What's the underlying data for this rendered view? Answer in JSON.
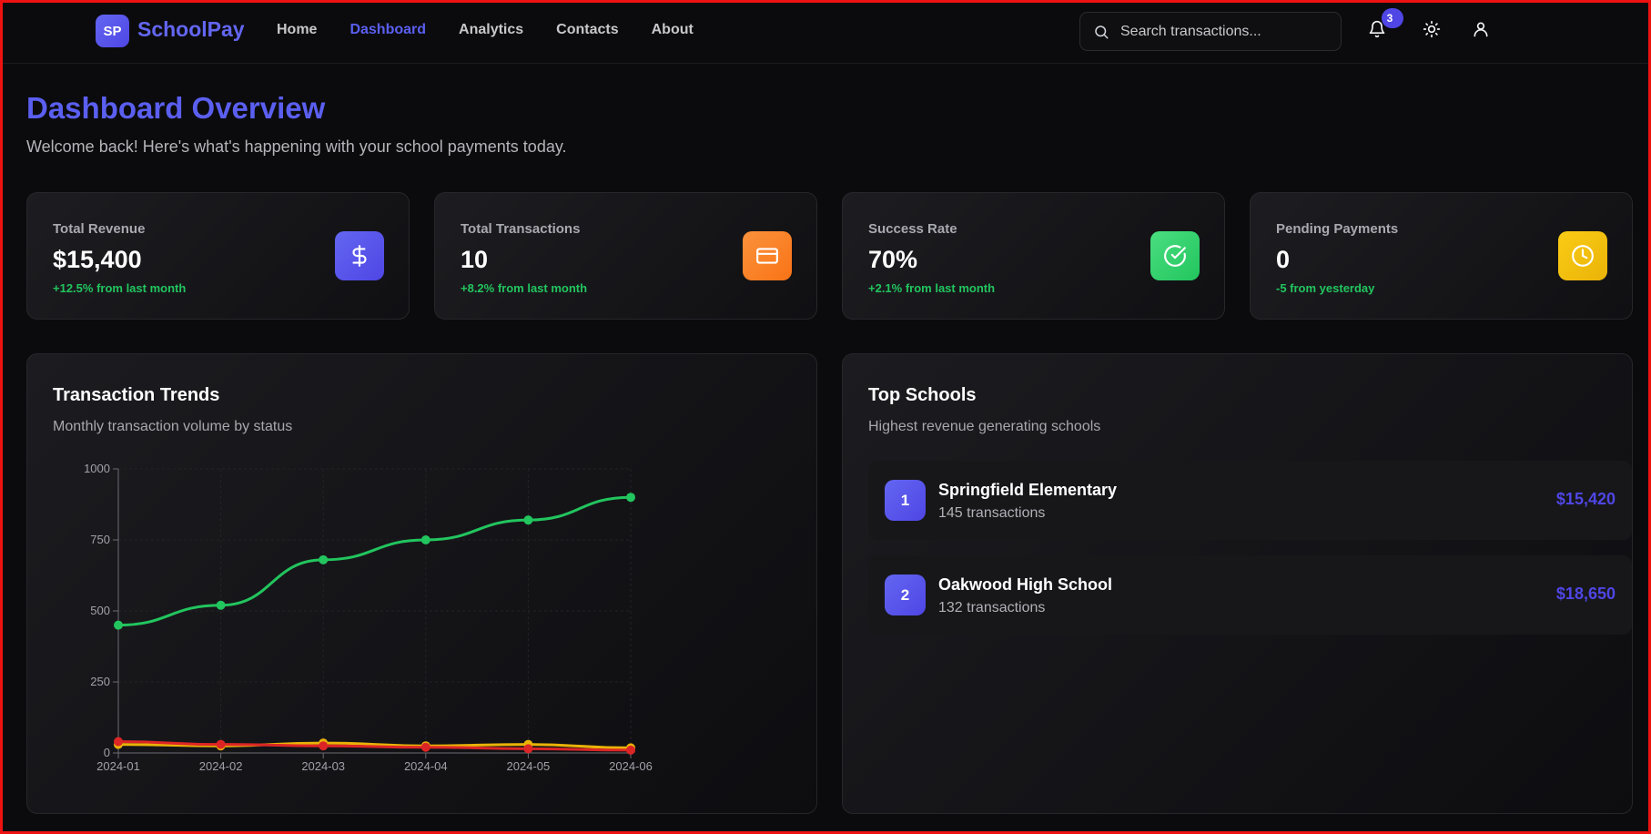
{
  "brand": {
    "logo_text": "SP",
    "name": "SchoolPay"
  },
  "nav": [
    {
      "label": "Home",
      "active": false
    },
    {
      "label": "Dashboard",
      "active": true
    },
    {
      "label": "Analytics",
      "active": false
    },
    {
      "label": "Contacts",
      "active": false
    },
    {
      "label": "About",
      "active": false
    }
  ],
  "search": {
    "placeholder": "Search transactions...",
    "icon": "search-icon"
  },
  "header_actions": {
    "notification_count": "3",
    "icons": [
      "bell-icon",
      "sun-icon",
      "user-icon"
    ]
  },
  "page": {
    "title": "Dashboard Overview",
    "subtitle": "Welcome back! Here's what's happening with your school payments today."
  },
  "stats": [
    {
      "label": "Total Revenue",
      "value": "$15,400",
      "delta": "+12.5% from last month",
      "icon": "dollar-icon",
      "color": "#6366f1"
    },
    {
      "label": "Total Transactions",
      "value": "10",
      "delta": "+8.2% from last month",
      "icon": "credit-card-icon",
      "color": "#fb923c"
    },
    {
      "label": "Success Rate",
      "value": "70%",
      "delta": "+2.1% from last month",
      "icon": "check-circle-icon",
      "color": "#22c55e"
    },
    {
      "label": "Pending Payments",
      "value": "0",
      "delta": "-5 from yesterday",
      "icon": "clock-icon",
      "color": "#eab308"
    }
  ],
  "trends": {
    "title": "Transaction Trends",
    "subtitle": "Monthly transaction volume by status"
  },
  "chart_data": {
    "type": "line",
    "x": [
      "2024-01",
      "2024-02",
      "2024-03",
      "2024-04",
      "2024-05",
      "2024-06"
    ],
    "series": [
      {
        "values": [
          450,
          520,
          680,
          750,
          820,
          900
        ],
        "color": "#22c55e"
      },
      {
        "values": [
          40,
          30,
          25,
          20,
          15,
          10
        ],
        "color": "#dc2626"
      },
      {
        "values": [
          30,
          25,
          35,
          25,
          30,
          18
        ],
        "color": "#eab308"
      }
    ],
    "yticks": [
      0,
      250,
      500,
      750,
      1000
    ],
    "ylim": [
      0,
      1000
    ],
    "grid": true,
    "legend": "none"
  },
  "top_schools": {
    "title": "Top Schools",
    "subtitle": "Highest revenue generating schools",
    "items": [
      {
        "rank": "1",
        "name": "Springfield Elementary",
        "transactions": "145 transactions",
        "amount": "$15,420"
      },
      {
        "rank": "2",
        "name": "Oakwood High School",
        "transactions": "132 transactions",
        "amount": "$18,650"
      }
    ]
  }
}
